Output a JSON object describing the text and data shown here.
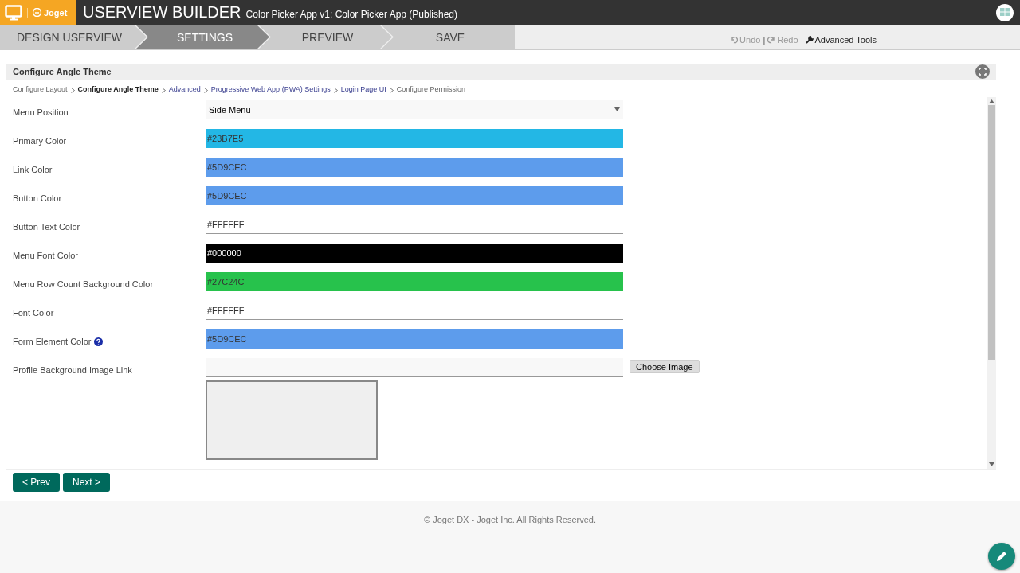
{
  "header": {
    "brand": "Joget",
    "title": "USERVIEW BUILDER",
    "subtitle": "Color Picker App v1: Color Picker App (Published)"
  },
  "steps": [
    {
      "label": "DESIGN USERVIEW",
      "selected": false
    },
    {
      "label": "SETTINGS",
      "selected": true
    },
    {
      "label": "PREVIEW",
      "selected": false
    },
    {
      "label": "SAVE",
      "selected": false
    }
  ],
  "toolbar": {
    "undo": "Undo",
    "separator": "|",
    "redo": "Redo",
    "advanced": "Advanced Tools"
  },
  "panel": {
    "title": "Configure Angle Theme",
    "breadcrumb": [
      {
        "label": "Configure Layout",
        "kind": "plain"
      },
      {
        "label": "Configure Angle Theme",
        "kind": "current"
      },
      {
        "label": "Advanced",
        "kind": "link"
      },
      {
        "label": "Progressive Web App (PWA) Settings",
        "kind": "link"
      },
      {
        "label": "Login Page UI",
        "kind": "link"
      },
      {
        "label": "Configure Permission",
        "kind": "plain"
      }
    ],
    "fields": [
      {
        "label": "Menu Position",
        "kind": "select",
        "value": "Side Menu"
      },
      {
        "label": "Primary Color",
        "kind": "color",
        "value": "#23B7E5",
        "color": "#23b7e5"
      },
      {
        "label": "Link Color",
        "kind": "color",
        "value": "#5D9CEC",
        "color": "#5d9cec"
      },
      {
        "label": "Button Color",
        "kind": "color",
        "value": "#5D9CEC",
        "color": "#5d9cec"
      },
      {
        "label": "Button Text Color",
        "kind": "color",
        "value": "#FFFFFF",
        "color": "#ffffff"
      },
      {
        "label": "Menu Font Color",
        "kind": "color",
        "value": "#000000",
        "color": "#000000"
      },
      {
        "label": "Menu Row Count Background Color",
        "kind": "color",
        "value": "#27C24C",
        "color": "#27c24c"
      },
      {
        "label": "Font Color",
        "kind": "color",
        "value": "#FFFFFF",
        "color": "#ffffff"
      },
      {
        "label": "Form Element Color",
        "kind": "color",
        "value": "#5D9CEC",
        "color": "#5d9cec",
        "help": true
      },
      {
        "label": "Profile Background Image Link",
        "kind": "image",
        "button": "Choose Image"
      }
    ],
    "buttons": [
      "< Prev",
      "Next >"
    ]
  },
  "footer": "© Joget DX - Joget Inc. All Rights Reserved."
}
